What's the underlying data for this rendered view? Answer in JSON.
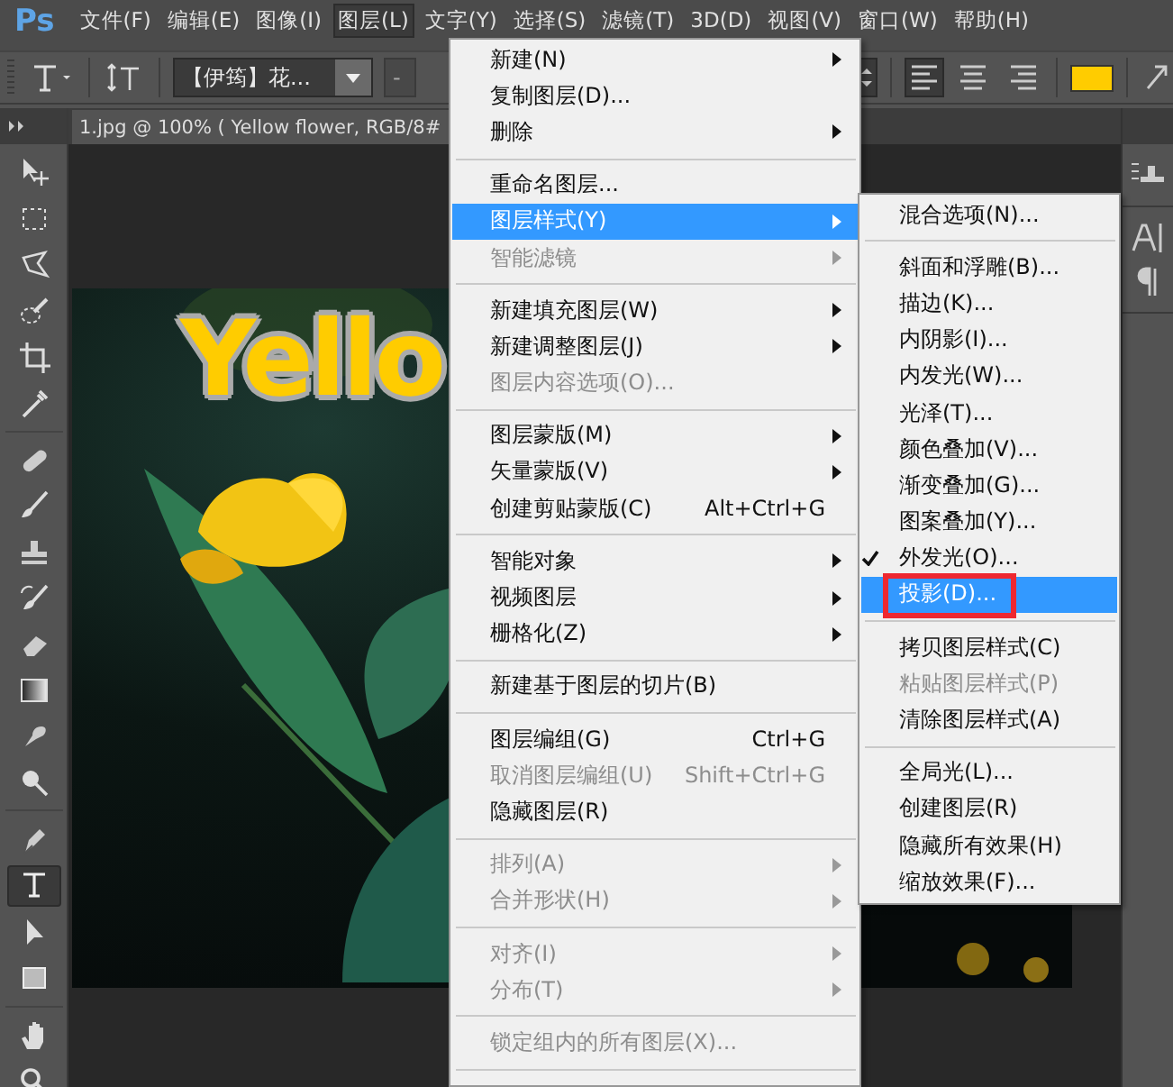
{
  "menubar": {
    "logo": "Ps",
    "items": [
      {
        "label": "文件(F)",
        "selected": false
      },
      {
        "label": "编辑(E)",
        "selected": false
      },
      {
        "label": "图像(I)",
        "selected": false
      },
      {
        "label": "图层(L)",
        "selected": true
      },
      {
        "label": "文字(Y)",
        "selected": false
      },
      {
        "label": "选择(S)",
        "selected": false
      },
      {
        "label": "滤镜(T)",
        "selected": false
      },
      {
        "label": "3D(D)",
        "selected": false
      },
      {
        "label": "视图(V)",
        "selected": false
      },
      {
        "label": "窗口(W)",
        "selected": false
      },
      {
        "label": "帮助(H)",
        "selected": false
      }
    ]
  },
  "options_bar": {
    "font_family": "【伊筠】花...",
    "font_style": "-",
    "alignment": [
      {
        "selected": true
      },
      {
        "selected": false
      },
      {
        "selected": false
      }
    ],
    "color_swatch": {
      "color": "#ffcc00"
    }
  },
  "document": {
    "tab_title": "1.jpg @ 100% ( Yellow flower, RGB/8#",
    "canvas_text": "Yello"
  },
  "tool_groups": [
    {
      "tools": [
        {
          "kind": "move",
          "selected": false
        },
        {
          "kind": "marquee",
          "selected": false
        },
        {
          "kind": "lasso",
          "selected": false
        },
        {
          "kind": "quick",
          "selected": false
        },
        {
          "kind": "crop",
          "selected": false
        },
        {
          "kind": "eyedropper",
          "selected": false
        }
      ]
    },
    {
      "tools": [
        {
          "kind": "healing",
          "selected": false
        },
        {
          "kind": "brush",
          "selected": false
        },
        {
          "kind": "stamp",
          "selected": false
        },
        {
          "kind": "history",
          "selected": false
        },
        {
          "kind": "eraser",
          "selected": false
        },
        {
          "kind": "gradient",
          "selected": false
        },
        {
          "kind": "smudge",
          "selected": false
        },
        {
          "kind": "dodge",
          "selected": false
        }
      ]
    },
    {
      "tools": [
        {
          "kind": "pen",
          "selected": false
        },
        {
          "kind": "type",
          "selected": true
        },
        {
          "kind": "path",
          "selected": false
        },
        {
          "kind": "rectangle",
          "selected": false
        }
      ]
    },
    {
      "tools": [
        {
          "kind": "hand",
          "selected": false
        },
        {
          "kind": "zoom",
          "selected": false
        }
      ]
    }
  ],
  "layer_menu": {
    "items": [
      {
        "kind": "item",
        "label": "新建(N)",
        "submenu": true,
        "disabled": false,
        "selected": false
      },
      {
        "kind": "item",
        "label": "复制图层(D)...",
        "submenu": false,
        "disabled": false,
        "selected": false
      },
      {
        "kind": "item",
        "label": "删除",
        "submenu": true,
        "disabled": false,
        "selected": false
      },
      {
        "kind": "separator"
      },
      {
        "kind": "item",
        "label": "重命名图层...",
        "submenu": false,
        "disabled": false,
        "selected": false
      },
      {
        "kind": "item",
        "label": "图层样式(Y)",
        "submenu": true,
        "disabled": false,
        "selected": true
      },
      {
        "kind": "item",
        "label": "智能滤镜",
        "submenu": true,
        "disabled": true,
        "selected": false
      },
      {
        "kind": "separator"
      },
      {
        "kind": "item",
        "label": "新建填充图层(W)",
        "submenu": true,
        "disabled": false,
        "selected": false
      },
      {
        "kind": "item",
        "label": "新建调整图层(J)",
        "submenu": true,
        "disabled": false,
        "selected": false
      },
      {
        "kind": "item",
        "label": "图层内容选项(O)...",
        "submenu": false,
        "disabled": true,
        "selected": false
      },
      {
        "kind": "separator"
      },
      {
        "kind": "item",
        "label": "图层蒙版(M)",
        "submenu": true,
        "disabled": false,
        "selected": false
      },
      {
        "kind": "item",
        "label": "矢量蒙版(V)",
        "submenu": true,
        "disabled": false,
        "selected": false
      },
      {
        "kind": "item",
        "label": "创建剪贴蒙版(C)",
        "shortcut": "Alt+Ctrl+G",
        "submenu": false,
        "disabled": false,
        "selected": false
      },
      {
        "kind": "separator"
      },
      {
        "kind": "item",
        "label": "智能对象",
        "submenu": true,
        "disabled": false,
        "selected": false
      },
      {
        "kind": "item",
        "label": "视频图层",
        "submenu": true,
        "disabled": false,
        "selected": false
      },
      {
        "kind": "item",
        "label": "栅格化(Z)",
        "submenu": true,
        "disabled": false,
        "selected": false
      },
      {
        "kind": "separator"
      },
      {
        "kind": "item",
        "label": "新建基于图层的切片(B)",
        "submenu": false,
        "disabled": false,
        "selected": false
      },
      {
        "kind": "separator"
      },
      {
        "kind": "item",
        "label": "图层编组(G)",
        "shortcut": "Ctrl+G",
        "submenu": false,
        "disabled": false,
        "selected": false
      },
      {
        "kind": "item",
        "label": "取消图层编组(U)",
        "shortcut": "Shift+Ctrl+G",
        "submenu": false,
        "disabled": true,
        "selected": false
      },
      {
        "kind": "item",
        "label": "隐藏图层(R)",
        "submenu": false,
        "disabled": false,
        "selected": false
      },
      {
        "kind": "separator"
      },
      {
        "kind": "item",
        "label": "排列(A)",
        "submenu": true,
        "disabled": true,
        "selected": false
      },
      {
        "kind": "item",
        "label": "合并形状(H)",
        "submenu": true,
        "disabled": true,
        "selected": false
      },
      {
        "kind": "separator"
      },
      {
        "kind": "item",
        "label": "对齐(I)",
        "submenu": true,
        "disabled": true,
        "selected": false
      },
      {
        "kind": "item",
        "label": "分布(T)",
        "submenu": true,
        "disabled": true,
        "selected": false
      },
      {
        "kind": "separator"
      },
      {
        "kind": "item",
        "label": "锁定组内的所有图层(X)...",
        "submenu": false,
        "disabled": true,
        "selected": false
      },
      {
        "kind": "separator"
      }
    ]
  },
  "style_submenu": {
    "items": [
      {
        "kind": "item",
        "label": "混合选项(N)...",
        "checked": false,
        "disabled": false,
        "selected": false,
        "annotated": false
      },
      {
        "kind": "separator"
      },
      {
        "kind": "item",
        "label": "斜面和浮雕(B)...",
        "checked": false,
        "disabled": false,
        "selected": false,
        "annotated": false
      },
      {
        "kind": "item",
        "label": "描边(K)...",
        "checked": false,
        "disabled": false,
        "selected": false,
        "annotated": false
      },
      {
        "kind": "item",
        "label": "内阴影(I)...",
        "checked": false,
        "disabled": false,
        "selected": false,
        "annotated": false
      },
      {
        "kind": "item",
        "label": "内发光(W)...",
        "checked": false,
        "disabled": false,
        "selected": false,
        "annotated": false
      },
      {
        "kind": "item",
        "label": "光泽(T)...",
        "checked": false,
        "disabled": false,
        "selected": false,
        "annotated": false
      },
      {
        "kind": "item",
        "label": "颜色叠加(V)...",
        "checked": false,
        "disabled": false,
        "selected": false,
        "annotated": false
      },
      {
        "kind": "item",
        "label": "渐变叠加(G)...",
        "checked": false,
        "disabled": false,
        "selected": false,
        "annotated": false
      },
      {
        "kind": "item",
        "label": "图案叠加(Y)...",
        "checked": false,
        "disabled": false,
        "selected": false,
        "annotated": false
      },
      {
        "kind": "item",
        "label": "外发光(O)...",
        "checked": true,
        "disabled": false,
        "selected": false,
        "annotated": false
      },
      {
        "kind": "item",
        "label": "投影(D)...",
        "checked": false,
        "disabled": false,
        "selected": true,
        "annotated": true
      },
      {
        "kind": "separator"
      },
      {
        "kind": "item",
        "label": "拷贝图层样式(C)",
        "checked": false,
        "disabled": false,
        "selected": false,
        "annotated": false
      },
      {
        "kind": "item",
        "label": "粘贴图层样式(P)",
        "checked": false,
        "disabled": true,
        "selected": false,
        "annotated": false
      },
      {
        "kind": "item",
        "label": "清除图层样式(A)",
        "checked": false,
        "disabled": false,
        "selected": false,
        "annotated": false
      },
      {
        "kind": "separator"
      },
      {
        "kind": "item",
        "label": "全局光(L)...",
        "checked": false,
        "disabled": false,
        "selected": false,
        "annotated": false
      },
      {
        "kind": "item",
        "label": "创建图层(R)",
        "checked": false,
        "disabled": false,
        "selected": false,
        "annotated": false
      },
      {
        "kind": "item",
        "label": "隐藏所有效果(H)",
        "checked": false,
        "disabled": false,
        "selected": false,
        "annotated": false
      },
      {
        "kind": "item",
        "label": "缩放效果(F)...",
        "checked": false,
        "disabled": false,
        "selected": false,
        "annotated": false
      }
    ]
  }
}
